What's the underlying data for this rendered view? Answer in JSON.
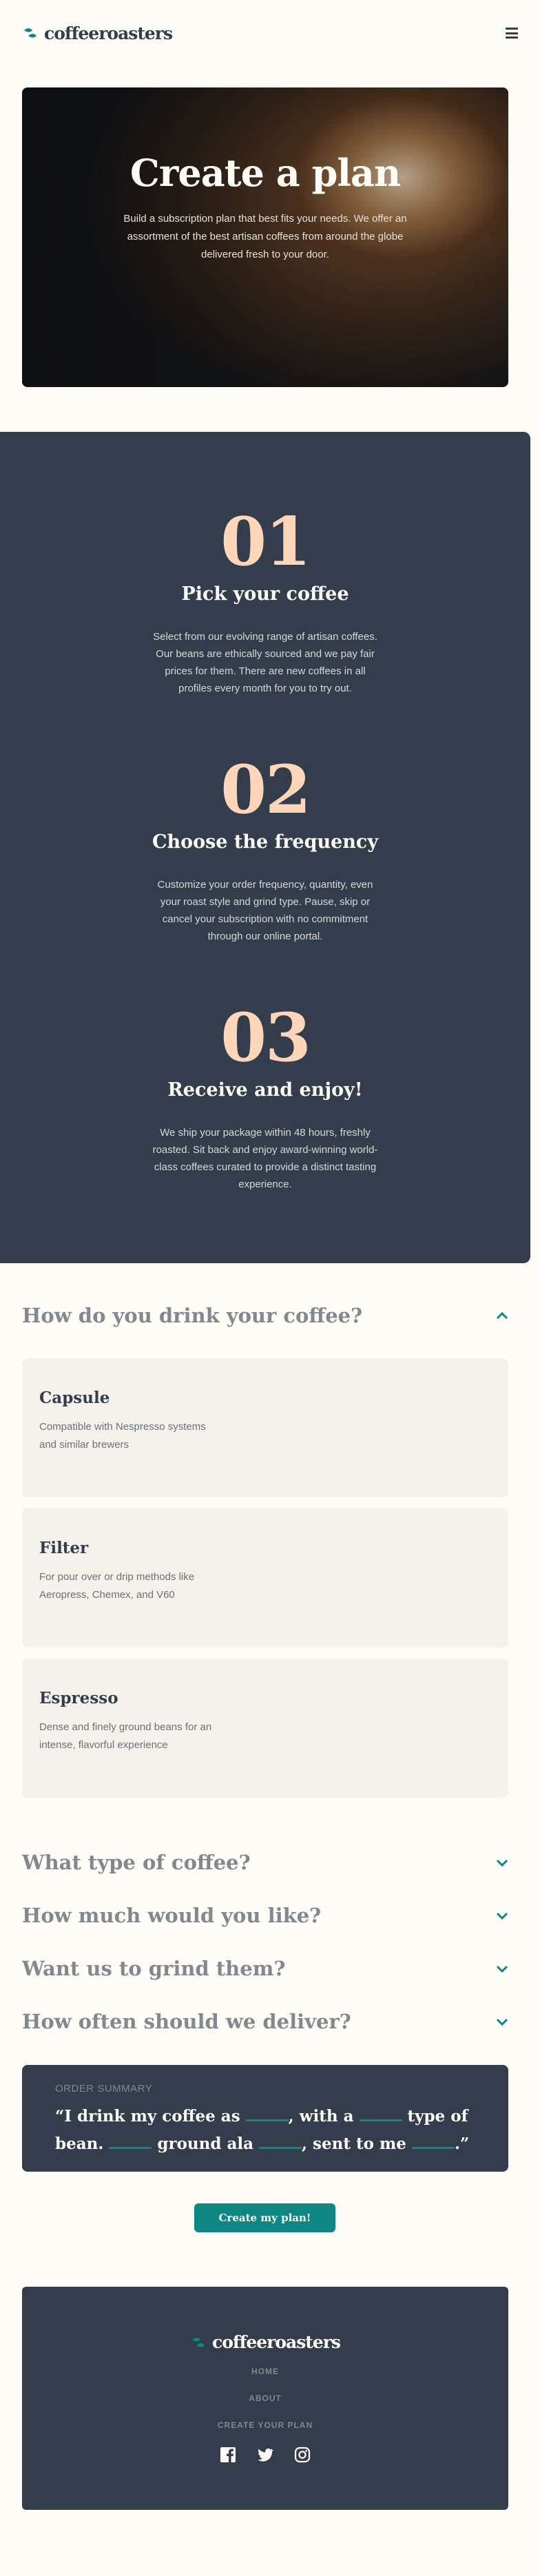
{
  "header": {
    "brand": "coffeeroasters",
    "menu_icon": "hamburger-icon"
  },
  "hero": {
    "title": "Create a plan",
    "text": "Build a subscription plan that best fits your needs. We offer an assortment of the best artisan coffees from around the globe delivered fresh to your door."
  },
  "steps": [
    {
      "number": "01",
      "title": "Pick your coffee",
      "text": "Select from our evolving range of artisan coffees. Our beans are ethically sourced and we pay fair prices for them. There are new coffees in all profiles every month for you to try out."
    },
    {
      "number": "02",
      "title": "Choose the frequency",
      "text": "Customize your order frequency, quantity, even your roast style and grind type. Pause, skip or cancel your subscription with no commitment through our online portal."
    },
    {
      "number": "03",
      "title": "Receive and enjoy!",
      "text": "We ship your package within 48 hours, freshly roasted. Sit back and enjoy award-winning world-class coffees curated to provide a distinct tasting experience."
    }
  ],
  "questions": [
    {
      "title": "How do you drink your coffee?",
      "expanded": true
    },
    {
      "title": "What type of coffee?",
      "expanded": false
    },
    {
      "title": "How much would you like?",
      "expanded": false
    },
    {
      "title": "Want us to grind them?",
      "expanded": false
    },
    {
      "title": "How often should we deliver?",
      "expanded": false
    }
  ],
  "options": [
    {
      "title": "Capsule",
      "desc": "Compatible with Nespresso systems and similar brewers"
    },
    {
      "title": "Filter",
      "desc": "For pour over or drip methods like Aeropress, Chemex, and V60"
    },
    {
      "title": "Espresso",
      "desc": "Dense and finely ground beans for an intense, flavorful experience"
    }
  ],
  "summary": {
    "label": "Order Summary",
    "open_quote": "“I drink my coffee as",
    "with_a": ", with a",
    "type_of": "type of",
    "bean": "bean.",
    "ground_ala": "ground ala",
    "sent_to_me": ", sent to me",
    "close": ".”"
  },
  "cta_label": "Create my plan!",
  "footer": {
    "brand": "coffeeroasters",
    "nav": [
      "HOME",
      "ABOUT",
      "CREATE YOUR PLAN"
    ],
    "social": [
      "facebook-icon",
      "twitter-icon",
      "instagram-icon"
    ]
  },
  "colors": {
    "accent": "#0e8784",
    "dark": "#333d4b",
    "number": "#fdd6ba",
    "background": "#fefcf7"
  }
}
